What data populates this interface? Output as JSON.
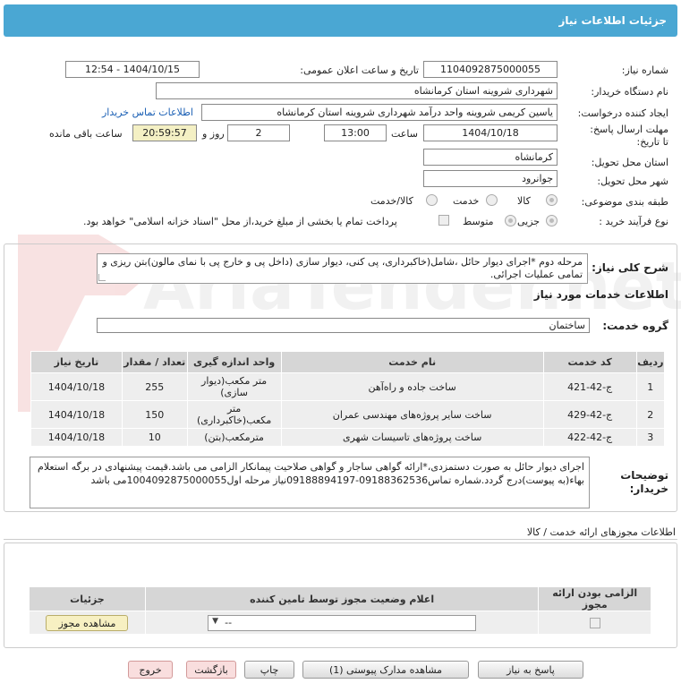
{
  "header": {
    "title": "جزئیات اطلاعات نیاز"
  },
  "need_number": {
    "label": "شماره نیاز:",
    "value": "1104092875000055"
  },
  "announce": {
    "label": "تاریخ و ساعت اعلان عمومی:",
    "value": "1404/10/15 - 12:54"
  },
  "buyer": {
    "label": "نام دستگاه خریدار:",
    "value": "شهرداری شروینه استان کرمانشاه"
  },
  "creator": {
    "label": "ایجاد کننده درخواست:",
    "value": "یاسین کریمی شروینه واحد درآمد شهرداری شروینه استان کرمانشاه",
    "contact_link": "اطلاعات تماس خریدار"
  },
  "deadline": {
    "label": "مهلت ارسال پاسخ: تا تاریخ:",
    "date": "1404/10/18",
    "time_label": "ساعت",
    "time": "13:00",
    "days": "2",
    "days_label": "روز و",
    "remaining": "20:59:57",
    "remaining_label": "ساعت باقی مانده"
  },
  "province": {
    "label": "استان محل تحویل:",
    "value": "کرمانشاه"
  },
  "city": {
    "label": "شهر محل تحویل:",
    "value": "جوانرود"
  },
  "category": {
    "label": "طبقه بندی موضوعی:",
    "options": [
      "کالا",
      "خدمت",
      "کالا/خدمت"
    ],
    "selected": "کالا"
  },
  "process": {
    "label": "نوع فرآیند خرید :",
    "options": [
      "جزیی",
      "متوسط"
    ],
    "selected": "جزیی",
    "payment_note": "پرداخت تمام یا بخشی از مبلغ خرید،از محل \"اسناد خزانه اسلامی\" خواهد بود."
  },
  "description": {
    "label": "شرح کلی نیاز:",
    "value": "مرحله دوم *اجرای دیوار حائل ،شامل(خاکبرداری، پی کنی، دیوار سازی (داخل پی و خارج پی با نمای مالون)بتن ریزی و تمامی عملیات اجرائی."
  },
  "services_title": "اطلاعات خدمات مورد نیاز",
  "service_group": {
    "label": "گروه خدمت:",
    "value": "ساختمان"
  },
  "services_table": {
    "headers": [
      "ردیف",
      "کد خدمت",
      "نام خدمت",
      "واحد اندازه گیری",
      "تعداد / مقدار",
      "تاریخ نیاز"
    ],
    "rows": [
      [
        "1",
        "ج-42-421",
        "ساخت جاده و راه‌آهن",
        "متر مکعب(دیوار سازی)",
        "255",
        "1404/10/18"
      ],
      [
        "2",
        "ج-42-429",
        "ساخت سایر پروژه‌های مهندسی عمران",
        "متر مکعب(خاکبرداری)",
        "150",
        "1404/10/18"
      ],
      [
        "3",
        "ج-42-422",
        "ساخت پروژه‌های تاسیسات شهری",
        "مترمکعب(بتن)",
        "10",
        "1404/10/18"
      ]
    ]
  },
  "buyer_notes": {
    "label": "توضیحات خریدار:",
    "value": "اجرای دیوار حائل به صورت دستمزدی،*ارائه گواهی ساجار و گواهی صلاحیت پیمانکار الزامی می باشد.قیمت پیشنهادی در برگه استعلام بهاء(به پیوست)درج گردد.شماره تماس09188362536-09188894197نیاز مرحله اول1004092875000055می باشد"
  },
  "permits": {
    "title": "اطلاعات مجوزهای ارائه خدمت / کالا",
    "headers": [
      "الزامی بودن ارائه مجوز",
      "اعلام وضعیت مجوز توسط تامین کننده",
      "جزئیات"
    ],
    "select_value": "--",
    "view_button": "مشاهده مجوز"
  },
  "buttons": {
    "reply": "پاسخ به نیاز",
    "docs": "مشاهده مدارک پیوستی (1)",
    "print": "چاپ",
    "back": "بازگشت",
    "exit": "خروج"
  },
  "watermark": "AriaTender.net"
}
